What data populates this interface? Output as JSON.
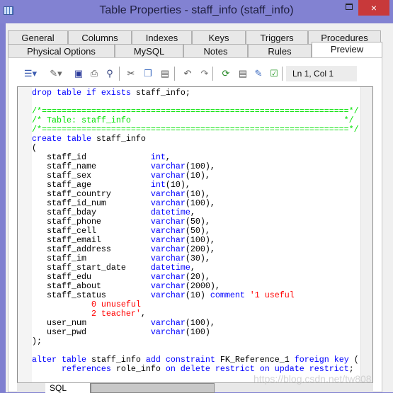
{
  "window": {
    "title": "Table Properties - staff_info (staff_info)",
    "close_icon": "×"
  },
  "tabs_row1": [
    "General",
    "Columns",
    "Indexes",
    "Keys",
    "Triggers",
    "Procedures"
  ],
  "tabs_row2": [
    "Physical Options",
    "MySQL",
    "Notes",
    "Rules",
    "Preview"
  ],
  "active_tab": "Preview",
  "toolbar": {
    "icons": [
      "format-dropdown-icon",
      "edit-dropdown-icon",
      "save-icon",
      "print-icon",
      "find-icon",
      "cut-icon",
      "copy-icon",
      "paste-icon",
      "undo-icon",
      "redo-icon",
      "refresh-icon",
      "properties-icon",
      "edit-script-icon",
      "check-icon"
    ],
    "position": "Ln 1, Col 1"
  },
  "code_lines": [
    [
      [
        "drop table if exists ",
        "k"
      ],
      [
        "staff_info;",
        "p"
      ]
    ],
    [],
    [
      [
        "/*==============================================================*/",
        "c"
      ]
    ],
    [
      [
        "/* Table: staff_info                                           */",
        "c"
      ]
    ],
    [
      [
        "/*==============================================================*/",
        "c"
      ]
    ],
    [
      [
        "create table ",
        "k"
      ],
      [
        "staff_info",
        "p"
      ]
    ],
    [
      [
        "(",
        "p"
      ]
    ],
    [
      [
        "   staff_id             ",
        "p"
      ],
      [
        "int",
        "k"
      ],
      [
        ",",
        "p"
      ]
    ],
    [
      [
        "   staff_name           ",
        "p"
      ],
      [
        "varchar",
        "k"
      ],
      [
        "(100),",
        "p"
      ]
    ],
    [
      [
        "   staff_sex            ",
        "p"
      ],
      [
        "varchar",
        "k"
      ],
      [
        "(10),",
        "p"
      ]
    ],
    [
      [
        "   staff_age            ",
        "p"
      ],
      [
        "int",
        "k"
      ],
      [
        "(10),",
        "p"
      ]
    ],
    [
      [
        "   staff_country        ",
        "p"
      ],
      [
        "varchar",
        "k"
      ],
      [
        "(10),",
        "p"
      ]
    ],
    [
      [
        "   staff_id_num         ",
        "p"
      ],
      [
        "varchar",
        "k"
      ],
      [
        "(100),",
        "p"
      ]
    ],
    [
      [
        "   staff_bday           ",
        "p"
      ],
      [
        "datetime",
        "k"
      ],
      [
        ",",
        "p"
      ]
    ],
    [
      [
        "   staff_phone          ",
        "p"
      ],
      [
        "varchar",
        "k"
      ],
      [
        "(50),",
        "p"
      ]
    ],
    [
      [
        "   staff_cell           ",
        "p"
      ],
      [
        "varchar",
        "k"
      ],
      [
        "(50),",
        "p"
      ]
    ],
    [
      [
        "   staff_email          ",
        "p"
      ],
      [
        "varchar",
        "k"
      ],
      [
        "(100),",
        "p"
      ]
    ],
    [
      [
        "   staff_address        ",
        "p"
      ],
      [
        "varchar",
        "k"
      ],
      [
        "(200),",
        "p"
      ]
    ],
    [
      [
        "   staff_im             ",
        "p"
      ],
      [
        "varchar",
        "k"
      ],
      [
        "(30),",
        "p"
      ]
    ],
    [
      [
        "   staff_start_date     ",
        "p"
      ],
      [
        "datetime",
        "k"
      ],
      [
        ",",
        "p"
      ]
    ],
    [
      [
        "   staff_edu            ",
        "p"
      ],
      [
        "varchar",
        "k"
      ],
      [
        "(20),",
        "p"
      ]
    ],
    [
      [
        "   staff_about          ",
        "p"
      ],
      [
        "varchar",
        "k"
      ],
      [
        "(2000),",
        "p"
      ]
    ],
    [
      [
        "   staff_status         ",
        "p"
      ],
      [
        "varchar",
        "k"
      ],
      [
        "(10) ",
        "p"
      ],
      [
        "comment",
        "k"
      ],
      [
        " '1 useful",
        "s"
      ]
    ],
    [
      [
        "            0 unuseful",
        "s"
      ]
    ],
    [
      [
        "            2 teacher'",
        "s"
      ],
      [
        ",",
        "p"
      ]
    ],
    [
      [
        "   user_num             ",
        "p"
      ],
      [
        "varchar",
        "k"
      ],
      [
        "(100),",
        "p"
      ]
    ],
    [
      [
        "   user_pwd             ",
        "p"
      ],
      [
        "varchar",
        "k"
      ],
      [
        "(100)",
        "p"
      ]
    ],
    [
      [
        ");",
        "p"
      ]
    ],
    [],
    [
      [
        "alter table ",
        "k"
      ],
      [
        "staff_info ",
        "p"
      ],
      [
        "add constraint ",
        "k"
      ],
      [
        "FK_Reference_1 ",
        "p"
      ],
      [
        "foreign key ",
        "k"
      ],
      [
        "(",
        "p"
      ]
    ],
    [
      [
        "      references ",
        "k"
      ],
      [
        "role_info ",
        "p"
      ],
      [
        "on delete restrict on update restrict",
        "k"
      ],
      [
        ";",
        "p"
      ]
    ]
  ],
  "bottom_tab": "SQL",
  "watermark": "https://blog.csdn.net/tw808"
}
